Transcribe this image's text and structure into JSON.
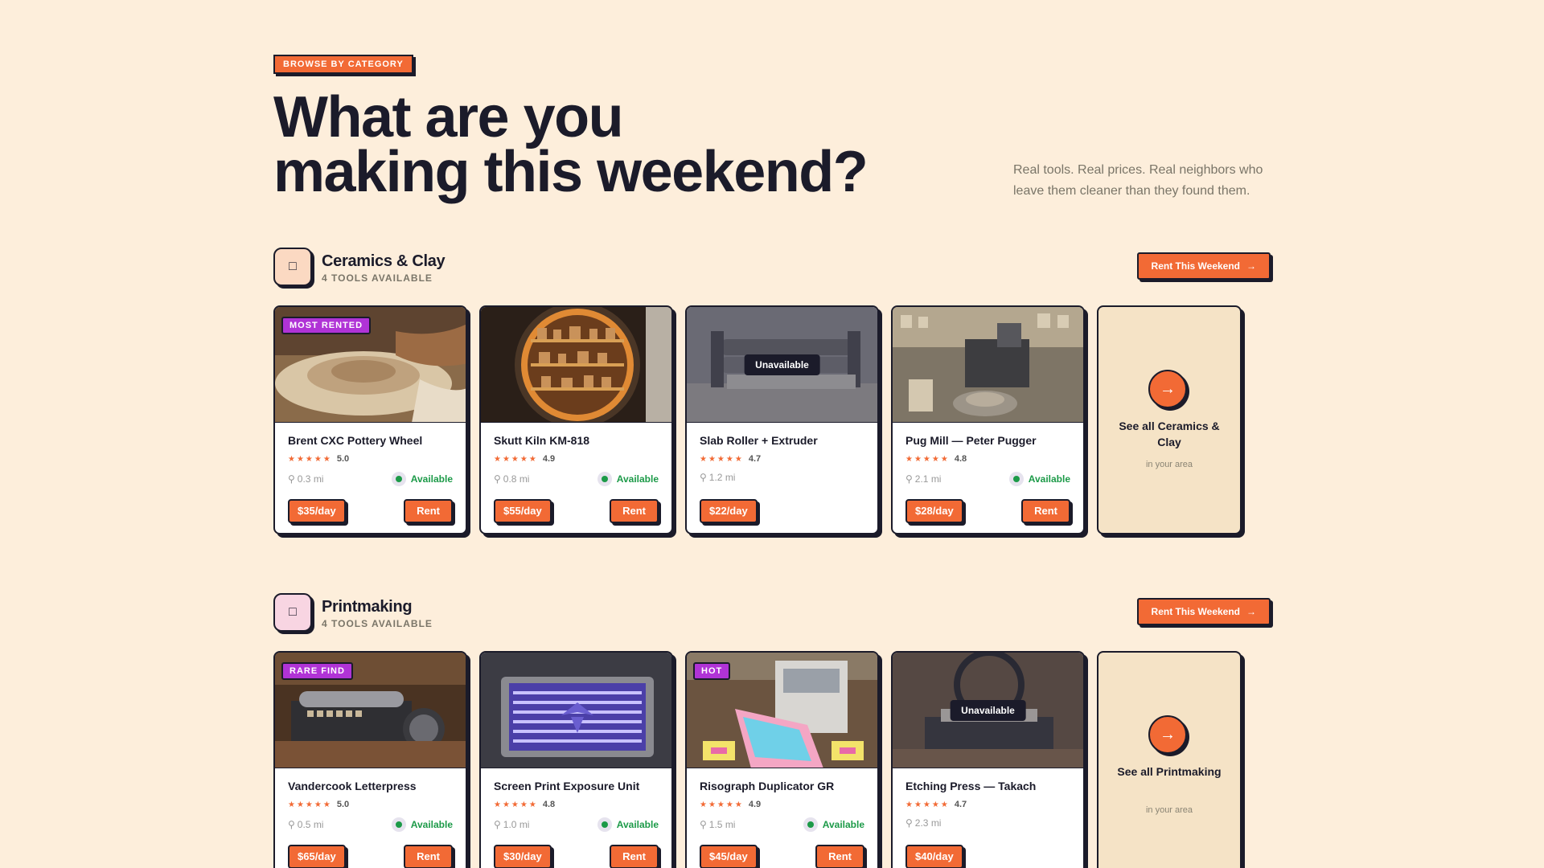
{
  "hero": {
    "eyebrow": "BROWSE BY CATEGORY",
    "headline_line1": "What are you",
    "headline_line2": "making this weekend?",
    "tagline": "Real tools. Real prices. Real neighbors who leave them cleaner than they found them."
  },
  "colors": {
    "background": "#fdeedb",
    "accent": "#f26a35",
    "ink": "#1b1b2a",
    "badge": "#b033d6",
    "available": "#1c9a48"
  },
  "sections": [
    {
      "title": "Ceramics & Clay",
      "count": "4 TOOLS AVAILABLE",
      "icon": "vase-icon",
      "cta": "Rent This Weekend",
      "see_all_title": "See all Ceramics & Clay",
      "see_all_sub": "in your area",
      "tools": [
        {
          "name": "Brent CXC Pottery Wheel",
          "rating": "5.0",
          "distance": "0.3 mi",
          "status": "Available",
          "price": "$35/day",
          "rent": "Rent",
          "badge": "MOST RENTED",
          "unavailable_label": ""
        },
        {
          "name": "Skutt Kiln KM-818",
          "rating": "4.9",
          "distance": "0.8 mi",
          "status": "Available",
          "price": "$55/day",
          "rent": "Rent",
          "badge": "",
          "unavailable_label": ""
        },
        {
          "name": "Slab Roller + Extruder",
          "rating": "4.7",
          "distance": "1.2 mi",
          "status": "",
          "price": "$22/day",
          "rent": "",
          "badge": "",
          "unavailable_label": "Unavailable"
        },
        {
          "name": "Pug Mill — Peter Pugger",
          "rating": "4.8",
          "distance": "2.1 mi",
          "status": "Available",
          "price": "$28/day",
          "rent": "Rent",
          "badge": "",
          "unavailable_label": ""
        }
      ]
    },
    {
      "title": "Printmaking",
      "count": "4 TOOLS AVAILABLE",
      "icon": "print-icon",
      "cta": "Rent This Weekend",
      "see_all_title": "See all Printmaking",
      "see_all_sub": "in your area",
      "tools": [
        {
          "name": "Vandercook Letterpress",
          "rating": "5.0",
          "distance": "0.5 mi",
          "status": "Available",
          "price": "$65/day",
          "rent": "Rent",
          "badge": "RARE FIND",
          "unavailable_label": ""
        },
        {
          "name": "Screen Print Exposure Unit",
          "rating": "4.8",
          "distance": "1.0 mi",
          "status": "Available",
          "price": "$30/day",
          "rent": "Rent",
          "badge": "",
          "unavailable_label": ""
        },
        {
          "name": "Risograph Duplicator GR",
          "rating": "4.9",
          "distance": "1.5 mi",
          "status": "Available",
          "price": "$45/day",
          "rent": "Rent",
          "badge": "HOT",
          "unavailable_label": ""
        },
        {
          "name": "Etching Press — Takach",
          "rating": "4.7",
          "distance": "2.3 mi",
          "status": "",
          "price": "$40/day",
          "rent": "",
          "badge": "",
          "unavailable_label": "Unavailable"
        }
      ]
    }
  ]
}
